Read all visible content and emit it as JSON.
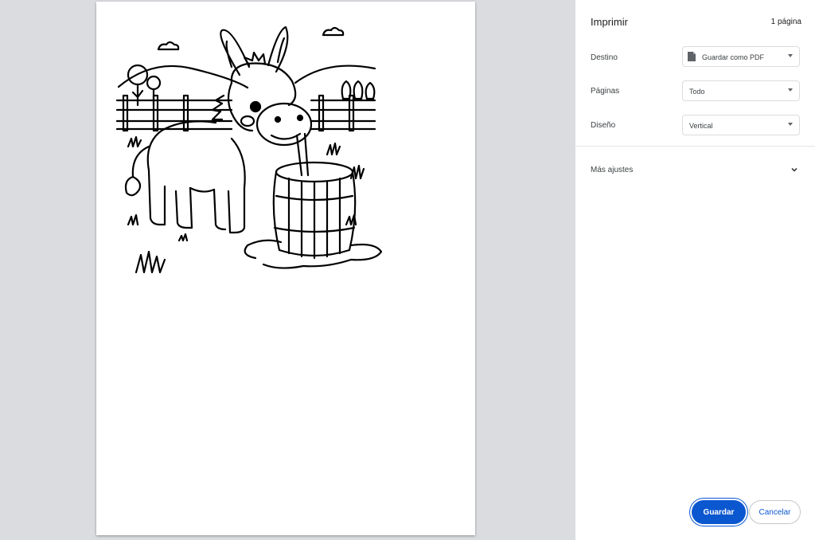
{
  "dialog": {
    "title": "Imprimir",
    "sheet_count": "1 página"
  },
  "settings": {
    "destination": {
      "label": "Destino",
      "value": "Guardar como PDF"
    },
    "pages": {
      "label": "Páginas",
      "value": "Todo"
    },
    "layout": {
      "label": "Diseño",
      "value": "Vertical"
    }
  },
  "more_settings": {
    "label": "Más ajustes"
  },
  "buttons": {
    "save": "Guardar",
    "cancel": "Cancelar"
  },
  "colors": {
    "primary": "#0b57d0",
    "preview_background": "#dadce0"
  },
  "preview": {
    "image": "donkey-drinking-from-barrel-coloring-page"
  }
}
